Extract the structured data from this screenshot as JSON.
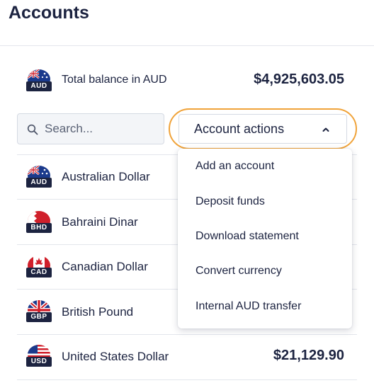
{
  "page": {
    "title": "Accounts"
  },
  "total": {
    "flag_icon": "australia-flag-icon",
    "code": "AUD",
    "label": "Total balance in AUD",
    "value": "$4,925,603.05"
  },
  "search": {
    "placeholder": "Search...",
    "value": ""
  },
  "actions": {
    "label": "Account actions",
    "accent_color": "#f0a33a",
    "expanded": true,
    "menu": [
      "Add an account",
      "Deposit funds",
      "Download statement",
      "Convert currency",
      "Internal AUD transfer"
    ]
  },
  "accounts": [
    {
      "code": "AUD",
      "name": "Australian Dollar",
      "flag_icon": "australia-flag-icon",
      "balance": ""
    },
    {
      "code": "BHD",
      "name": "Bahraini Dinar",
      "flag_icon": "bahrain-flag-icon",
      "balance": ""
    },
    {
      "code": "CAD",
      "name": "Canadian Dollar",
      "flag_icon": "canada-flag-icon",
      "balance": ""
    },
    {
      "code": "GBP",
      "name": "British Pound",
      "flag_icon": "uk-flag-icon",
      "balance": ""
    },
    {
      "code": "USD",
      "name": "United States Dollar",
      "flag_icon": "usa-flag-icon",
      "balance": "$21,129.90"
    }
  ]
}
